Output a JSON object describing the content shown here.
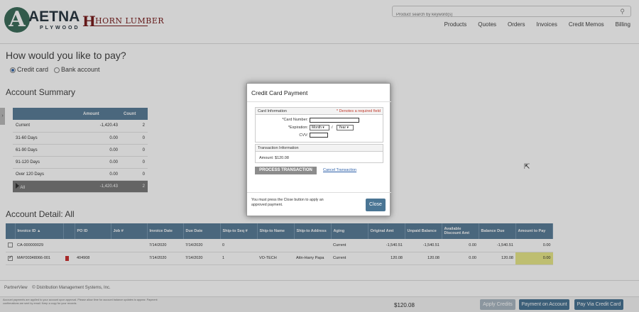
{
  "header": {
    "logo_letter": "A",
    "logo_name": "AETNA",
    "logo_sub": "PLYWOOD",
    "partner_logo_letter": "H",
    "partner_logo": "HORN LUMBER",
    "search_placeholder": "Product search by keyword(s)",
    "nav": [
      "Products",
      "Quotes",
      "Orders",
      "Invoices",
      "Credit Memos",
      "Billing"
    ]
  },
  "payment": {
    "title": "How would you like to pay?",
    "options": [
      "Credit card",
      "Bank account"
    ],
    "selected": "Credit card"
  },
  "summary": {
    "title": "Account Summary",
    "columns": [
      "",
      "Amount",
      "Count"
    ],
    "rows": [
      {
        "label": "Current",
        "amount": "-1,420.43",
        "count": "2"
      },
      {
        "label": "31-60 Days",
        "amount": "0.00",
        "count": "0"
      },
      {
        "label": "61-90 Days",
        "amount": "0.00",
        "count": "0"
      },
      {
        "label": "91-120 Days",
        "amount": "0.00",
        "count": "0"
      },
      {
        "label": "Over 120 Days",
        "amount": "0.00",
        "count": "0"
      }
    ],
    "total": {
      "label": "All",
      "amount": "-1,420.43",
      "count": "2"
    }
  },
  "detail": {
    "title": "Account Detail: All",
    "columns": [
      "Invoice ID",
      "",
      "PO ID",
      "Job #",
      "Invoice Date",
      "Due Date",
      "Ship-to Seq #",
      "Ship-to Name",
      "Ship-to Address",
      "Aging",
      "Original Amt",
      "Unpaid Balance",
      "Available Discount Amt",
      "Balance Due",
      "Amount to Pay"
    ],
    "rows": [
      {
        "checked": false,
        "invoice": "CA-000000029",
        "pdf": false,
        "po": "",
        "job": "",
        "inv_date": "7/14/2020",
        "due": "7/14/2020",
        "seq": "0",
        "ship_name": "",
        "ship_addr": "",
        "aging": "Current",
        "orig": "-1,540.51",
        "unpaid": "-1,540.51",
        "disc": "0.00",
        "bal": "-1,540.51",
        "pay": "0.00"
      },
      {
        "checked": true,
        "invoice": "MAY00348066-001",
        "pdf": true,
        "po": "404908",
        "job": "",
        "inv_date": "7/14/2020",
        "due": "7/14/2020",
        "seq": "1",
        "ship_name": "VO-TECH",
        "ship_addr": "Attn-Harry Papa",
        "aging": "Current",
        "orig": "120.08",
        "unpaid": "120.08",
        "disc": "0.00",
        "bal": "120.08",
        "pay": "0.00"
      }
    ]
  },
  "footer": {
    "left": "PartnerView",
    "copyright": "© Distribution Management Systems, Inc.",
    "fine_print": "Account payments are applied to your account upon approval. Please allow time for account balance updates to appear. Payment confirmations are sent by email. Keep a copy for your records.",
    "total": "$120.08",
    "buttons": [
      "Apply Credits",
      "Payment on Account",
      "Pay Via Credit Card"
    ]
  },
  "modal": {
    "title": "Credit Card Payment",
    "card_info_legend": "Card Information",
    "required_note": "* Denotes a required field",
    "card_number_label": "*Card Number:",
    "expiration_label": "*Expiration:",
    "month_placeholder": "Month",
    "year_placeholder": "Year",
    "slash": "/",
    "cvv_label": "CVV:",
    "transaction_legend": "Transaction Information",
    "amount_text": "Amount: $120.08",
    "process_button": "PROCESS TRANSACTION",
    "cancel_link": "Cancel Transaction",
    "note": "You must press the Close button to apply an approved payment.",
    "close_button": "Close"
  },
  "icons": {
    "search": "search-icon",
    "pdf": "pdf-icon",
    "cursor": "mouse-cursor-icon",
    "expand": "expand-tab-icon"
  }
}
